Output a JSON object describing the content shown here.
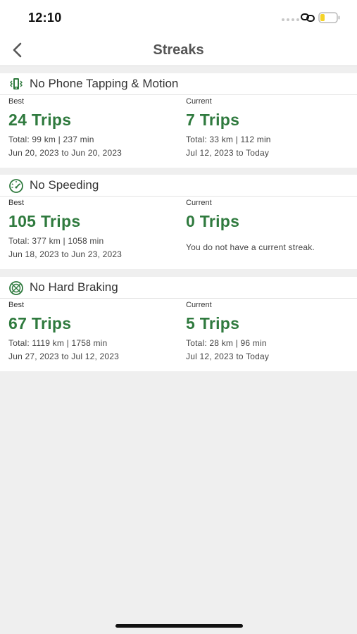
{
  "status_bar": {
    "time": "12:10",
    "battery_color": "#f5d327"
  },
  "nav": {
    "title": "Streaks",
    "back_icon": "chevron-left-icon"
  },
  "accent_color": "#2f7a3e",
  "streaks": [
    {
      "title": "No Phone Tapping & Motion",
      "icon": "phone-vibrate-icon",
      "best": {
        "label": "Best",
        "trips": "24 Trips",
        "total": "Total: 99 km | 237 min",
        "range": "Jun 20, 2023 to Jun 20, 2023"
      },
      "current": {
        "label": "Current",
        "trips": "7 Trips",
        "total": "Total: 33 km | 112 min",
        "range": "Jul 12, 2023 to Today"
      }
    },
    {
      "title": "No Speeding",
      "icon": "speedometer-icon",
      "best": {
        "label": "Best",
        "trips": "105 Trips",
        "total": "Total: 377 km | 1058 min",
        "range": "Jun 18, 2023 to Jun 23, 2023"
      },
      "current": {
        "label": "Current",
        "trips": "0 Trips",
        "note": "You do not have a current streak."
      }
    },
    {
      "title": "No Hard Braking",
      "icon": "brake-disc-icon",
      "best": {
        "label": "Best",
        "trips": "67 Trips",
        "total": "Total: 1119 km | 1758 min",
        "range": "Jun 27, 2023 to Jul 12, 2023"
      },
      "current": {
        "label": "Current",
        "trips": "5 Trips",
        "total": "Total: 28 km | 96 min",
        "range": "Jul 12, 2023 to Today"
      }
    }
  ]
}
